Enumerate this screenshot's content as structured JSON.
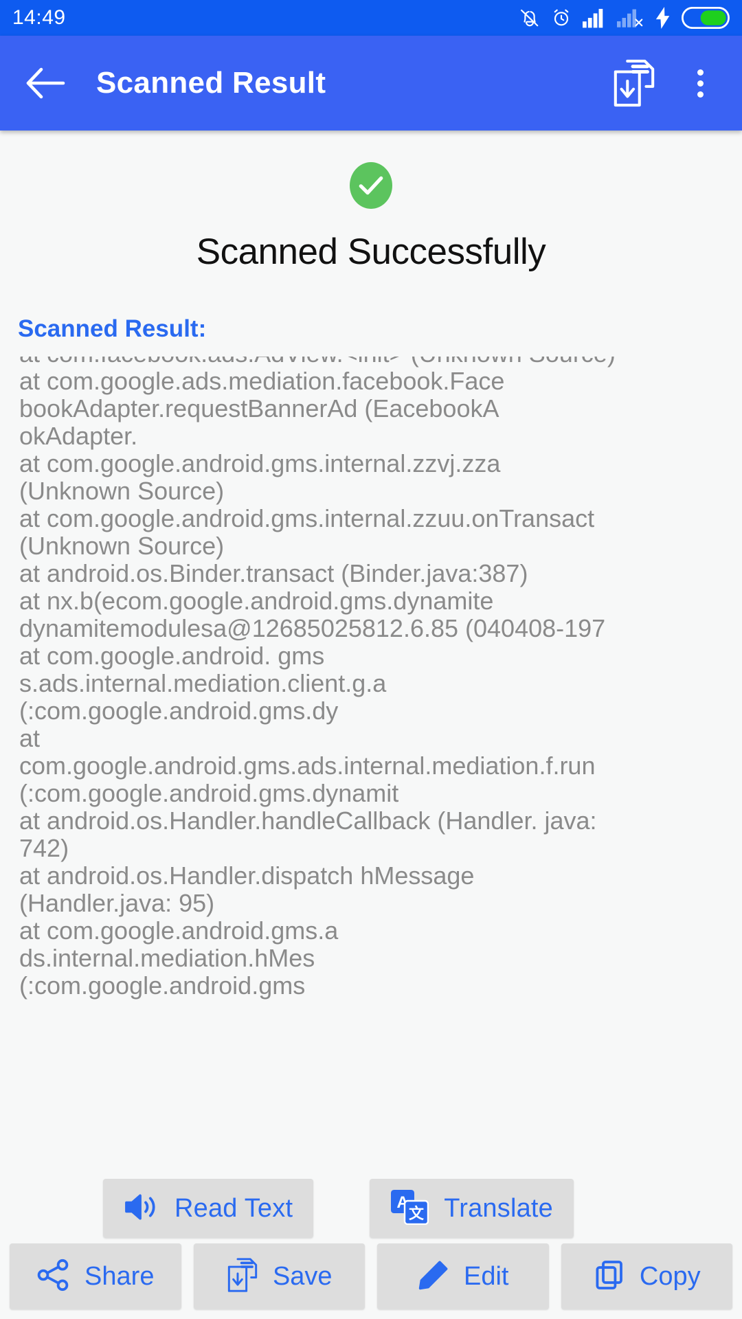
{
  "status_bar": {
    "time": "14:49",
    "icons": [
      "bell-muted-icon",
      "alarm-icon",
      "signal-full-icon",
      "signal-no-service-icon",
      "charging-bolt-icon",
      "battery-icon"
    ]
  },
  "app_bar": {
    "back_label": "back-arrow",
    "title": "Scanned Result",
    "save_icon_label": "save-document-icon",
    "overflow_label": "more-options"
  },
  "success": {
    "check_icon": "check-circle-icon",
    "title": "Scanned Successfully"
  },
  "result": {
    "label": "Scanned Result:",
    "text": "at com.facebook.ads.AdView.<init> (Unknown Source)\nat com.google.ads.mediation.facebook.Face\nbookAdapter.requestBannerAd (EacebookA\nokAdapter.\nat com.google.android.gms.internal.zzvj.zza\n(Unknown Source)\nat com.google.android.gms.internal.zzuu.onTransact\n(Unknown Source)\nat android.os.Binder.transact (Binder.java:387)\nat nx.b(ecom.google.android.gms.dynamite\ndynamitemodulesa@12685025812.6.85 (040408-197\nat com.google.android. gms\ns.ads.internal.mediation.client.g.a\n(:com.google.android.gms.dy\nat\ncom.google.android.gms.ads.internal.mediation.f.run\n(:com.google.android.gms.dynamit\nat android.os.Handler.handleCallback (Handler. java:\n742)\nat android.os.Handler.dispatch hMessage\n(Handler.java: 95)\nat com.google.android.gms.a\nds.internal.mediation.hMes\n(:com.google.android.gms"
  },
  "float_actions": [
    {
      "label": "Read Text",
      "icon": "speaker-volume-icon"
    },
    {
      "label": "Translate",
      "icon": "translate-icon"
    }
  ],
  "bottom_actions": [
    {
      "label": "Share",
      "icon": "share-icon"
    },
    {
      "label": "Save",
      "icon": "save-document-icon"
    },
    {
      "label": "Edit",
      "icon": "pencil-icon"
    },
    {
      "label": "Copy",
      "icon": "copy-icon"
    }
  ],
  "colors": {
    "status_bar": "#0e5bf0",
    "app_bar": "#3a62f3",
    "accent": "#2a6af0",
    "success_green": "#5cc45e",
    "page_bg": "#f7f8f8",
    "button_bg": "#dddddd",
    "ocr_text": "#8a8a8a"
  }
}
